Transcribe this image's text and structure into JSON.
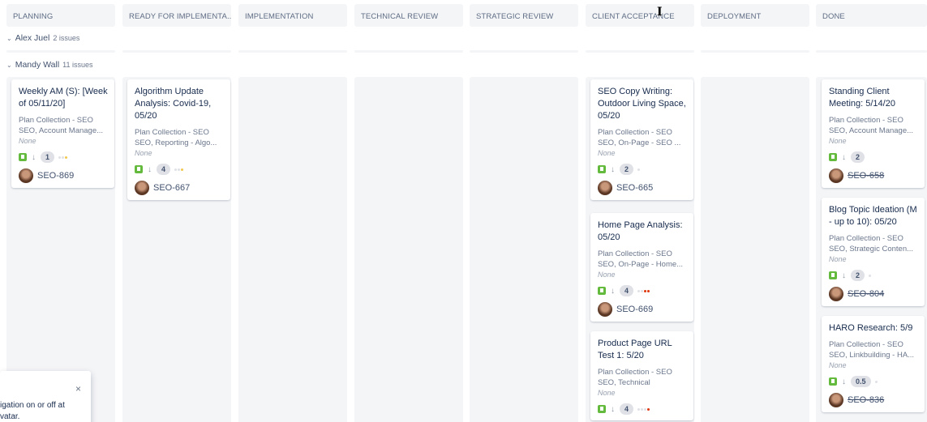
{
  "columns": [
    {
      "id": "planning",
      "label": "PLANNING"
    },
    {
      "id": "ready",
      "label": "READY FOR IMPLEMENTA..."
    },
    {
      "id": "implementation",
      "label": "IMPLEMENTATION"
    },
    {
      "id": "technical-review",
      "label": "TECHNICAL REVIEW"
    },
    {
      "id": "strategic-review",
      "label": "STRATEGIC REVIEW"
    },
    {
      "id": "client-acceptance",
      "label": "CLIENT ACCEPTANCE"
    },
    {
      "id": "deployment",
      "label": "DEPLOYMENT"
    },
    {
      "id": "done",
      "label": "DONE"
    }
  ],
  "swimlanes": [
    {
      "name": "Alex Juel",
      "count": "2 issues"
    },
    {
      "name": "Mandy Wall",
      "count": "11 issues"
    }
  ],
  "cards": {
    "planning": [
      {
        "summary": "Weekly AM (S): [Week of 05/11/20]",
        "epic": "Plan Collection - SEO",
        "components": "SEO, Account Manage...",
        "fix": "None",
        "estimate": "1",
        "dots": [
          "#dfe1e6",
          "#dfe1e6",
          "#f2c94c"
        ],
        "key": "SEO-869",
        "done": false
      }
    ],
    "ready": [
      {
        "summary": "Algorithm Update Analysis: Covid-19, 05/20",
        "epic": "Plan Collection - SEO",
        "components": "SEO, Reporting - Algo...",
        "fix": "None",
        "estimate": "4",
        "dots": [
          "#dfe1e6",
          "#dfe1e6",
          "#f2c94c"
        ],
        "key": "SEO-667",
        "done": false
      }
    ],
    "client_acceptance": [
      {
        "summary": "SEO Copy Writing: Outdoor Living Space, 05/20",
        "epic": "Plan Collection - SEO",
        "components": "SEO, On-Page - SEO ...",
        "fix": "None",
        "estimate": "2",
        "dots": [
          "#dfe1e6"
        ],
        "key": "SEO-665",
        "done": false
      },
      {
        "summary": "Home Page Analysis: 05/20",
        "epic": "Plan Collection - SEO",
        "components": "SEO, On-Page - Home...",
        "fix": "None",
        "estimate": "4",
        "dots": [
          "#dfe1e6",
          "#dfe1e6",
          "#de350b",
          "#de350b"
        ],
        "key": "SEO-669",
        "done": false
      },
      {
        "summary": "Product Page URL Test 1: 5/20",
        "epic": "Plan Collection - SEO",
        "components": "SEO, Technical",
        "fix": "None",
        "estimate": "4",
        "dots": [
          "#dfe1e6",
          "#dfe1e6",
          "#dfe1e6",
          "#de350b"
        ],
        "key": "",
        "done": false
      }
    ],
    "done": [
      {
        "summary": "Standing Client Meeting: 5/14/20",
        "epic": "Plan Collection - SEO",
        "components": "SEO, Account Manage...",
        "fix": "None",
        "estimate": "2",
        "dots": [],
        "key": "SEO-658",
        "done": true
      },
      {
        "summary": "Blog Topic Ideation (M - up to 10): 05/20",
        "epic": "Plan Collection - SEO",
        "components": "SEO, Strategic Conten...",
        "fix": "None",
        "estimate": "2",
        "dots": [
          "#dfe1e6"
        ],
        "key": "SEO-804",
        "done": true
      },
      {
        "summary": "HARO Research: 5/9",
        "epic": "Plan Collection - SEO",
        "components": "SEO, Linkbuilding - HA...",
        "fix": "None",
        "estimate": "0.5",
        "dots": [
          "#dfe1e6"
        ],
        "key": "SEO-836",
        "done": true
      }
    ]
  },
  "toast": {
    "text_line1": "igation on or off at",
    "text_line2": "vatar.",
    "close_icon": "×"
  },
  "icons": {
    "story": "story-icon",
    "priority": "↓",
    "chevron": "⌄"
  }
}
